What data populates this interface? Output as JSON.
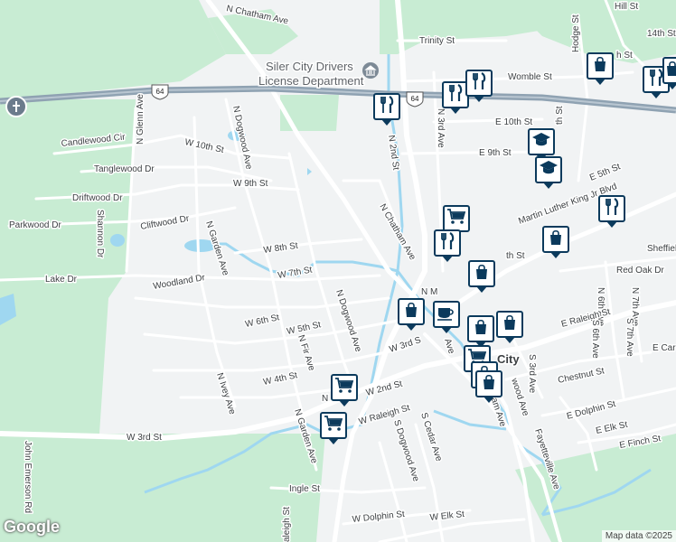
{
  "colors": {
    "background": "#f1f3f4",
    "park": "#c8ecd3",
    "park_light": "#d8f3df",
    "water": "#9fd7f0",
    "road": "#ffffff",
    "highway": "#8fa2b2",
    "marker_border": "#0b3a5c"
  },
  "streets": {
    "n_chatham_ave_top": "N Chatham Ave",
    "trinity_st": "Trinity St",
    "hill_st": "Hill St",
    "hodge_st": "Hodge St",
    "fourteenth_st": "14th St",
    "h_st": "h St",
    "womble_st": "Womble St",
    "e_10th_st": "E 10th St",
    "n_3rd_ave": "N 3rd Ave",
    "n_2nd_st": "N 2nd St",
    "e_9th_st": "E 9th St",
    "mlk_blvd": "Martin Luther King Jr Blvd",
    "e_5th_st": "E 5th St",
    "sheffield": "Sheffiel",
    "red_oak_dr": "Red Oak Dr",
    "n_6th_ave": "N 6th Ave",
    "n_7th_ave": "N 7th Ave",
    "e_raleigh_st": "E Raleigh St",
    "s_6th_ave": "S 6th Ave",
    "s_7th_ave": "S 7th Ave",
    "e_car": "E Car",
    "s_3rd_ave": "S 3rd Ave",
    "chestnut_st": "Chestnut St",
    "e_dolphin_st": "E Dolphin St",
    "e_elk_st": "E Elk St",
    "e_finch_st": "E Finch St",
    "fayetteville_ave": "Fayetteville Ave",
    "candlewood_cir": "Candlewood Cir",
    "n_glenn_ave": "N Glenn Ave",
    "w_10th_st": "W 10th St",
    "n_dogwood_ave_top": "N Dogwood Ave",
    "tanglewood_dr": "Tanglewood Dr",
    "w_9th_st": "W 9th St",
    "driftwood_dr": "Driftwood Dr",
    "parkwood_dr": "Parkwood Dr",
    "cliftwood_dr": "Cliftwood Dr",
    "n_garden_ave": "N Garden Ave",
    "shannon_dr": "Shannon Dr",
    "w_8th_st": "W 8th St",
    "w_7th_st": "W 7th St",
    "lake_dr": "Lake Dr",
    "woodland_dr": "Woodland Dr",
    "n_chatham_ave_mid": "N Chatham Ave",
    "n_dogwood_ave_mid": "N Dogwood Ave",
    "w_6th_st": "W 6th St",
    "w_5th_st": "W 5th St",
    "n_fir_ave": "N Fir Ave",
    "w_4th_st": "W 4th St",
    "n_ivey_ave": "N Ivey Ave",
    "w_3rd_st_mid": "W 3rd S",
    "w_2nd_st": "W 2nd St",
    "w_3rd_st_left": "W 3rd St",
    "w_raleigh_st": "W Raleigh St",
    "s_cedar_ave": "S Cedar Ave",
    "s_dogwood_ave": "S Dogwood Ave",
    "n_garden_ave_low": "N Garden Ave",
    "n_ma": "N",
    "ave_frag": "Ave",
    "john_emerson_rd": "John Emerson Rd",
    "ingle_st": "Ingle St",
    "raleigh_st_vert": "aleigh St",
    "w_dolphin_st": "W Dolphin St",
    "w_elk_st": "W Elk St",
    "ham_ave": "ham Ave",
    "wood_ave": "wood Ave",
    "th_st": "th St",
    "n_m": "N M",
    "n_st": "N"
  },
  "highway": {
    "shield": "64"
  },
  "poi": {
    "dmv_line1": "Siler City Drivers",
    "dmv_line2": "License Department",
    "city": "City"
  },
  "markers": [
    {
      "icon": "shopping-bag",
      "name": "marker-shopping-1"
    },
    {
      "icon": "restaurant",
      "name": "marker-restaurant-1"
    },
    {
      "icon": "restaurant",
      "name": "marker-restaurant-2"
    },
    {
      "icon": "restaurant",
      "name": "marker-restaurant-3"
    },
    {
      "icon": "restaurant",
      "name": "marker-restaurant-4"
    },
    {
      "icon": "shopping-bag",
      "name": "marker-shopping-2"
    },
    {
      "icon": "school",
      "name": "marker-school-1"
    },
    {
      "icon": "school",
      "name": "marker-school-2"
    },
    {
      "icon": "restaurant",
      "name": "marker-restaurant-5"
    },
    {
      "icon": "shopping-cart",
      "name": "marker-cart-1"
    },
    {
      "icon": "restaurant",
      "name": "marker-restaurant-6"
    },
    {
      "icon": "shopping-bag",
      "name": "marker-shopping-3"
    },
    {
      "icon": "shopping-bag",
      "name": "marker-shopping-4"
    },
    {
      "icon": "shopping-bag",
      "name": "marker-shopping-5"
    },
    {
      "icon": "coffee",
      "name": "marker-coffee-1"
    },
    {
      "icon": "shopping-bag",
      "name": "marker-shopping-6"
    },
    {
      "icon": "shopping-bag",
      "name": "marker-shopping-7"
    },
    {
      "icon": "shopping-cart",
      "name": "marker-cart-2"
    },
    {
      "icon": "shopping-bag",
      "name": "marker-shopping-8"
    },
    {
      "icon": "shopping-bag",
      "name": "marker-shopping-9"
    },
    {
      "icon": "shopping-cart",
      "name": "marker-cart-3"
    },
    {
      "icon": "shopping-cart",
      "name": "marker-cart-4"
    }
  ],
  "footer": {
    "logo": "Google",
    "attribution": "Map data ©2025"
  }
}
